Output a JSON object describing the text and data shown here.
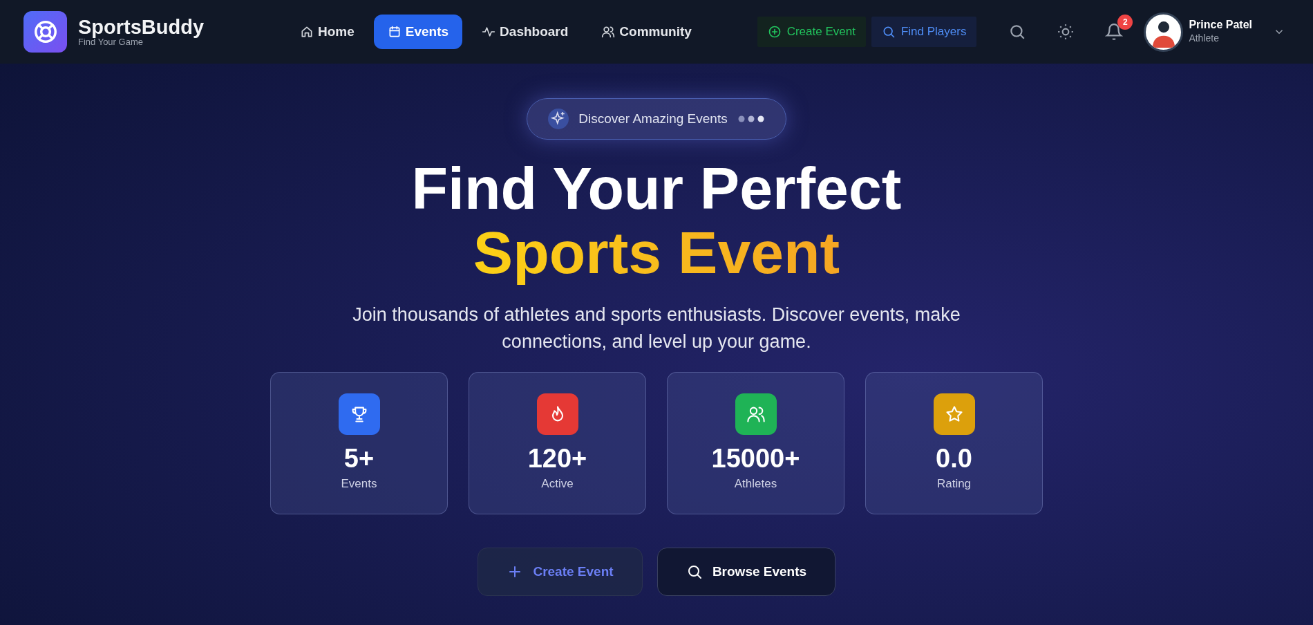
{
  "brand": {
    "name": "SportsBuddy",
    "tagline": "Find Your Game"
  },
  "nav": [
    {
      "label": "Home",
      "kind": "home",
      "selected": false
    },
    {
      "label": "Events",
      "kind": "calendar",
      "selected": true
    },
    {
      "label": "Dashboard",
      "kind": "pulse",
      "selected": false
    },
    {
      "label": "Community",
      "kind": "users",
      "selected": false
    }
  ],
  "actions": [
    {
      "label": "Create Event",
      "kind": "create"
    },
    {
      "label": "Find Players",
      "kind": "find"
    }
  ],
  "notifications": {
    "count": "2"
  },
  "user": {
    "name": "Prince Patel",
    "role": "Athlete"
  },
  "hero": {
    "pill": "Discover Amazing Events",
    "title_line1": "Find Your Perfect",
    "title_line2": "Sports Event",
    "subtitle": "Join thousands of athletes and sports enthusiasts. Discover events, make connections, and level up your game."
  },
  "stats": [
    {
      "value": "5+",
      "label": "Events",
      "kind": "trophy",
      "color": "#2f6bf0"
    },
    {
      "value": "120+",
      "label": "Active",
      "kind": "flame",
      "color": "#e53935"
    },
    {
      "value": "15000+",
      "label": "Athletes",
      "kind": "users",
      "color": "#1fb356"
    },
    {
      "value": "0.0",
      "label": "Rating",
      "kind": "star",
      "color": "#dca00c"
    }
  ],
  "buttons": [
    {
      "label": "Create Event",
      "kind": "create"
    },
    {
      "label": "Browse Events",
      "kind": "browse"
    }
  ]
}
